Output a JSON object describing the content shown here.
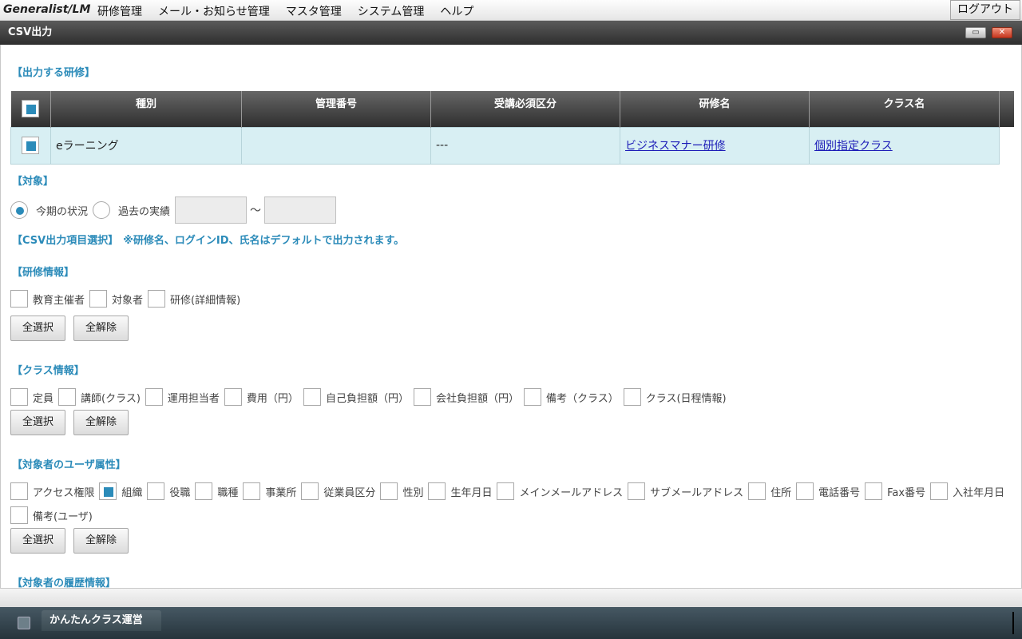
{
  "topbar": {
    "brand": "Generalist/LM",
    "menu": [
      "研修管理",
      "メール・お知らせ管理",
      "マスタ管理",
      "システム管理",
      "ヘルプ"
    ],
    "logout": "ログアウト"
  },
  "window": {
    "title": "CSV出力",
    "maximize_icon": "maximize-icon",
    "close_icon": "close-icon"
  },
  "training_section": {
    "heading": "【出力する研修】",
    "columns": [
      "種別",
      "管理番号",
      "受講必須区分",
      "研修名",
      "クラス名"
    ],
    "header_checkbox_checked": true,
    "rows": [
      {
        "checked": true,
        "type": "eラーニング",
        "id": "",
        "required": "---",
        "course": "ビジネスマナー研修",
        "class": "個別指定クラス"
      }
    ]
  },
  "target": {
    "heading": "【対象】",
    "option_current": "今期の状況",
    "option_past": "過去の実績",
    "selected": "current",
    "range_sep": "～",
    "date_from": "",
    "date_to": ""
  },
  "csv_items": {
    "heading": "【CSV出力項目選択】",
    "note": "※研修名、ログインID、氏名はデフォルトで出力されます。"
  },
  "training_info": {
    "heading": "【研修情報】",
    "items": [
      {
        "label": "教育主催者",
        "checked": false
      },
      {
        "label": "対象者",
        "checked": false
      },
      {
        "label": "研修(詳細情報)",
        "checked": false
      }
    ]
  },
  "class_info": {
    "heading": "【クラス情報】",
    "items": [
      {
        "label": "定員",
        "checked": false
      },
      {
        "label": "講師(クラス)",
        "checked": false
      },
      {
        "label": "運用担当者",
        "checked": false
      },
      {
        "label": "費用（円）",
        "checked": false
      },
      {
        "label": "自己負担額（円）",
        "checked": false
      },
      {
        "label": "会社負担額（円）",
        "checked": false
      },
      {
        "label": "備考（クラス）",
        "checked": false
      },
      {
        "label": "クラス(日程情報)",
        "checked": false
      }
    ]
  },
  "user_attr": {
    "heading": "【対象者のユーザ属性】",
    "items": [
      {
        "label": "アクセス権限",
        "checked": false
      },
      {
        "label": "組織",
        "checked": true
      },
      {
        "label": "役職",
        "checked": false
      },
      {
        "label": "職種",
        "checked": false
      },
      {
        "label": "事業所",
        "checked": false
      },
      {
        "label": "従業員区分",
        "checked": false
      },
      {
        "label": "性別",
        "checked": false
      },
      {
        "label": "生年月日",
        "checked": false
      },
      {
        "label": "メインメールアドレス",
        "checked": false
      },
      {
        "label": "サブメールアドレス",
        "checked": false
      },
      {
        "label": "住所",
        "checked": false
      },
      {
        "label": "電話番号",
        "checked": false
      },
      {
        "label": "Fax番号",
        "checked": false
      },
      {
        "label": "入社年月日",
        "checked": false
      },
      {
        "label": "備考(ユーザ)",
        "checked": false
      }
    ]
  },
  "history": {
    "heading": "【対象者の履歴情報】"
  },
  "buttons": {
    "select_all": "全選択",
    "clear_all": "全解除"
  },
  "taskbar": {
    "task_label": "かんたんクラス運営"
  }
}
